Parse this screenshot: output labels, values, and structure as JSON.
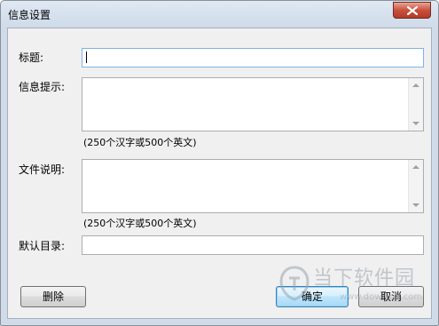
{
  "window": {
    "title": "信息设置",
    "close_icon": "close-icon"
  },
  "form": {
    "title_label": "标题:",
    "title_value": "",
    "info_label": "信息提示:",
    "info_value": "",
    "info_hint": "(250个汉字或500个英文)",
    "desc_label": "文件说明:",
    "desc_value": "",
    "desc_hint": "(250个汉字或500个英文)",
    "dir_label": "默认目录:",
    "dir_value": ""
  },
  "buttons": {
    "delete": "删除",
    "ok": "确定",
    "cancel": "取消"
  },
  "watermark": {
    "brand": "当下软件园",
    "url": "www.downxia.com"
  }
}
